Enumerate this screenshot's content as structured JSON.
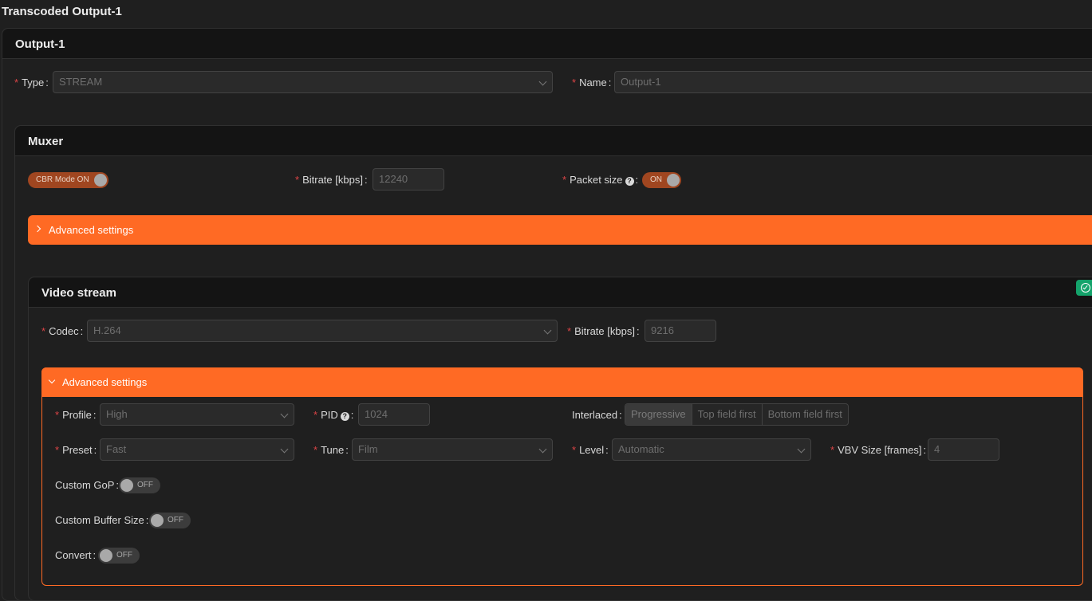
{
  "page": {
    "title": "Transcoded Output-1"
  },
  "output": {
    "title": "Output-1",
    "type_label": "Type",
    "type_value": "STREAM",
    "name_label": "Name",
    "name_placeholder": "Output-1"
  },
  "muxer": {
    "title": "Muxer",
    "cbr_switch": {
      "label": "CBR Mode ON",
      "state": "on"
    },
    "bitrate_label": "Bitrate [kbps]",
    "bitrate_placeholder": "12240",
    "packet_size_label": "Packet size",
    "packet_size_switch": {
      "label": "ON",
      "state": "on"
    },
    "advanced_label": "Advanced settings"
  },
  "video": {
    "title": "Video stream",
    "codec_label": "Codec",
    "codec_value": "H.264",
    "bitrate_label": "Bitrate [kbps]",
    "bitrate_placeholder": "9216",
    "advanced_label": "Advanced settings",
    "profile_label": "Profile",
    "profile_value": "High",
    "pid_label": "PID",
    "pid_placeholder": "1024",
    "interlaced_label": "Interlaced",
    "interlaced_options": [
      "Progressive",
      "Top field first",
      "Bottom field first"
    ],
    "interlaced_selected": "Progressive",
    "preset_label": "Preset",
    "preset_value": "Fast",
    "tune_label": "Tune",
    "tune_value": "Film",
    "level_label": "Level",
    "level_value": "Automatic",
    "vbv_label": "VBV Size [frames]",
    "vbv_placeholder": "4",
    "custom_gop_label": "Custom GoP",
    "custom_gop_switch": {
      "label": "OFF",
      "state": "off"
    },
    "custom_buffer_label": "Custom Buffer Size",
    "custom_buffer_switch": {
      "label": "OFF",
      "state": "off"
    },
    "convert_label": "Convert",
    "convert_switch": {
      "label": "OFF",
      "state": "off"
    }
  },
  "icons": {
    "help": "question-circle-icon",
    "status": "check-circle-icon",
    "chevron": "chevron-down-icon"
  },
  "colors": {
    "accent": "#ff6a24",
    "switch_on": "#a04620",
    "success": "#14a36b",
    "required": "#dc4446"
  }
}
